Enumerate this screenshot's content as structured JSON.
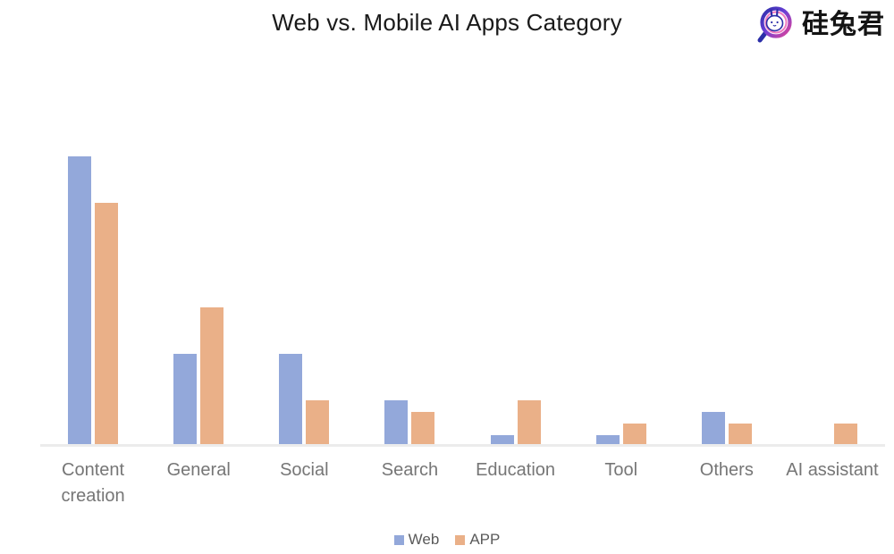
{
  "header": {
    "title": "Web vs. Mobile AI Apps Category",
    "brand_text": "硅兔君",
    "brand_icon": "magnifier-rabbit-logo-icon"
  },
  "chart_data": {
    "type": "bar",
    "title": "Web vs. Mobile AI Apps Category",
    "xlabel": "",
    "ylabel": "",
    "ylim": [
      0,
      30
    ],
    "yticks": [
      0,
      5,
      10,
      15,
      20,
      25,
      30
    ],
    "grid": false,
    "legend_position": "bottom",
    "categories": [
      "Content creation",
      "General",
      "Social",
      "Search",
      "Education",
      "Tool",
      "Others",
      "AI assistant"
    ],
    "series": [
      {
        "name": "Web",
        "color": "#93a8da",
        "values": [
          25,
          8,
          8,
          4,
          1,
          1,
          3,
          0
        ]
      },
      {
        "name": "APP",
        "color": "#eab088",
        "values": [
          21,
          12,
          4,
          3,
          4,
          2,
          2,
          2
        ]
      }
    ]
  },
  "legend": {
    "items": [
      {
        "label": "Web",
        "color": "#93a8da"
      },
      {
        "label": "APP",
        "color": "#eab088"
      }
    ]
  },
  "colors": {
    "web": "#93a8da",
    "app": "#eab088",
    "axis": "#ececec",
    "tick_text": "#808080",
    "category_text": "#767676",
    "title_text": "#1a1a1a",
    "background": "#ffffff"
  }
}
